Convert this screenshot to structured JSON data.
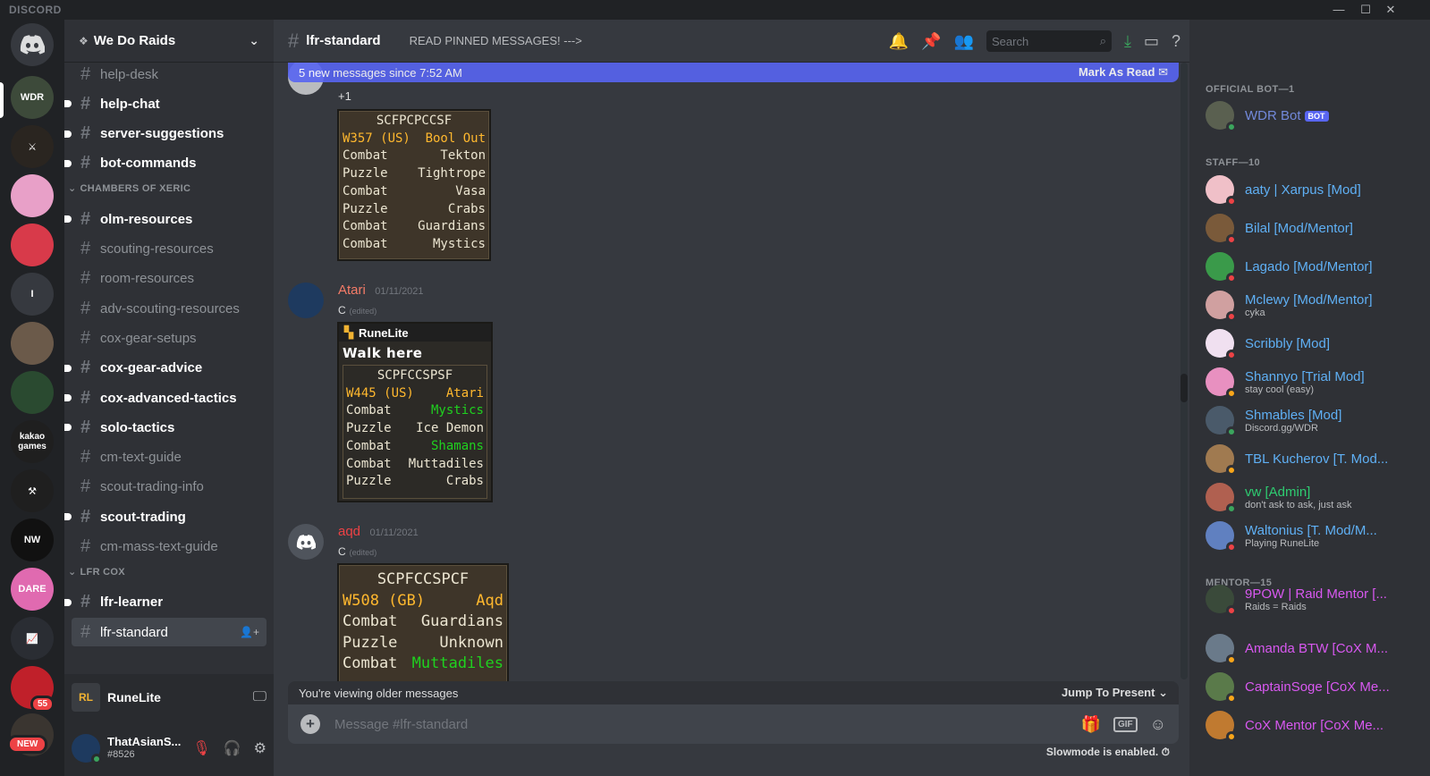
{
  "app": {
    "brand": "DISCORD"
  },
  "window_controls": {
    "minimize": "—",
    "maximize": "☐",
    "close": "✕"
  },
  "rail": {
    "home_icon": "discord-logo-icon",
    "servers": [
      {
        "label": "WDR",
        "color": "#3d4a3a"
      },
      {
        "label": "⚔",
        "color": "#2a2520"
      },
      {
        "label": "",
        "color": "#e8a0c8"
      },
      {
        "label": "",
        "color": "#d83a4a"
      },
      {
        "label": "I",
        "color": "#36393f"
      },
      {
        "label": "",
        "color": "#6b5a4a"
      },
      {
        "label": "",
        "color": "#2a4a30"
      },
      {
        "label": "kakao games",
        "color": "#1f1f1f"
      },
      {
        "label": "⚒",
        "color": "#1f1f1f"
      },
      {
        "label": "NW",
        "color": "#111111"
      },
      {
        "label": "DARE",
        "color": "#e06ab0"
      },
      {
        "label": "📈",
        "color": "#2a2d33"
      },
      {
        "label": "",
        "color": "#c0202a"
      },
      {
        "label": "",
        "color": "#3a3530"
      }
    ],
    "mention_badge": "55",
    "new_badge": "NEW"
  },
  "guild": {
    "name": "We Do Raids"
  },
  "channels": {
    "top": [
      {
        "name": "help-desk",
        "unread": false
      },
      {
        "name": "help-chat",
        "unread": true
      },
      {
        "name": "server-suggestions",
        "unread": true
      },
      {
        "name": "bot-commands",
        "unread": true
      }
    ],
    "cat1": "CHAMBERS OF XERIC",
    "cox": [
      {
        "name": "olm-resources",
        "unread": true
      },
      {
        "name": "scouting-resources",
        "unread": false
      },
      {
        "name": "room-resources",
        "unread": false
      },
      {
        "name": "adv-scouting-resources",
        "unread": false
      },
      {
        "name": "cox-gear-setups",
        "unread": false
      },
      {
        "name": "cox-gear-advice",
        "unread": true
      },
      {
        "name": "cox-advanced-tactics",
        "unread": true
      },
      {
        "name": "solo-tactics",
        "unread": true
      },
      {
        "name": "cm-text-guide",
        "unread": false
      },
      {
        "name": "scout-trading-info",
        "unread": false
      },
      {
        "name": "scout-trading",
        "unread": true
      },
      {
        "name": "cm-mass-text-guide",
        "unread": false
      }
    ],
    "cat2": "LFR COX",
    "lfr": [
      {
        "name": "lfr-learner",
        "unread": true
      },
      {
        "name": "lfr-standard",
        "selected": true
      }
    ]
  },
  "stream": {
    "name": "RuneLite"
  },
  "user": {
    "name": "ThatAsianS...",
    "tag": "#8526"
  },
  "chat": {
    "channel": "lfr-standard",
    "topic": "READ PINNED MESSAGES! --->",
    "search_placeholder": "Search",
    "new_banner": "5 new messages since 7:52 AM",
    "mark_read": "Mark As Read",
    "older": "You're viewing older messages",
    "jump": "Jump To Present",
    "composer_placeholder": "Message #lfr-standard",
    "gif": "GIF",
    "slowmode": "Slowmode is enabled."
  },
  "messages": [
    {
      "text": "+1",
      "card": {
        "title": "SCFPCPCCSF",
        "rows": [
          {
            "l": "W357 (US)",
            "r": "Bool Out",
            "lc": "ylw",
            "rc": "ylw"
          },
          {
            "l": "Combat",
            "r": "Tekton",
            "lc": "wht",
            "rc": "wht"
          },
          {
            "l": "Puzzle",
            "r": "Tightrope",
            "lc": "wht",
            "rc": "wht"
          },
          {
            "l": "Combat",
            "r": "Vasa",
            "lc": "wht",
            "rc": "wht"
          },
          {
            "l": "Puzzle",
            "r": "Crabs",
            "lc": "wht",
            "rc": "wht"
          },
          {
            "l": "Combat",
            "r": "Guardians",
            "lc": "wht",
            "rc": "wht"
          },
          {
            "l": "Combat",
            "r": "Mystics",
            "lc": "wht",
            "rc": "wht"
          }
        ]
      }
    },
    {
      "author": "Atari",
      "color": "#f47b67",
      "time": "01/11/2021",
      "text": "C",
      "edited": "(edited)",
      "rl_title": "RuneLite",
      "walk": "Walk here",
      "card": {
        "title": "SCPFCCSPSF",
        "rows": [
          {
            "l": "W445 (US)",
            "r": "Atari",
            "lc": "ylw",
            "rc": "ylw"
          },
          {
            "l": "Combat",
            "r": "Mystics",
            "lc": "wht",
            "rc": "grn"
          },
          {
            "l": "Puzzle",
            "r": "Ice Demon",
            "lc": "wht",
            "rc": "wht"
          },
          {
            "l": "Combat",
            "r": "Shamans",
            "lc": "wht",
            "rc": "grn"
          },
          {
            "l": "Combat",
            "r": "Muttadiles",
            "lc": "wht",
            "rc": "wht"
          },
          {
            "l": "Puzzle",
            "r": "Crabs",
            "lc": "wht",
            "rc": "wht"
          }
        ]
      }
    },
    {
      "author": "aqd",
      "color": "#ed4245",
      "time": "01/11/2021",
      "text": "C",
      "edited": "(edited)",
      "card": {
        "title": "SCPFCCSPCF",
        "rows": [
          {
            "l": "W508 (GB)",
            "r": "Aqd",
            "lc": "ylw",
            "rc": "ylw"
          },
          {
            "l": "Combat",
            "r": "Guardians",
            "lc": "wht",
            "rc": "wht"
          },
          {
            "l": "Puzzle",
            "r": "Unknown",
            "lc": "wht",
            "rc": "wht"
          },
          {
            "l": "Combat",
            "r": "Muttadiles",
            "lc": "wht",
            "rc": "grn"
          }
        ]
      }
    }
  ],
  "members": {
    "sections": [
      {
        "title": "OFFICIAL BOT—1"
      },
      {
        "title": "STAFF—10"
      },
      {
        "title": "MENTOR—15"
      }
    ],
    "list": [
      {
        "name": "WDR Bot",
        "color": "#7289da",
        "bot": "BOT",
        "status": "",
        "sd": "#3ba55d",
        "av": "#5a6050"
      },
      {
        "name": "aaty | Xarpus [Mod]",
        "color": "#5fb0f5",
        "status": "",
        "sd": "#ed4245",
        "av": "#f0c0c8"
      },
      {
        "name": "Bilal [Mod/Mentor]",
        "color": "#5fb0f5",
        "status": "",
        "sd": "#ed4245",
        "av": "#7a5a3a"
      },
      {
        "name": "Lagado [Mod/Mentor]",
        "color": "#5fb0f5",
        "status": "",
        "sd": "#ed4245",
        "av": "#3a9a4a"
      },
      {
        "name": "Mclewy [Mod/Mentor]",
        "color": "#5fb0f5",
        "status": "cyka",
        "sd": "#ed4245",
        "av": "#d0a0a0"
      },
      {
        "name": "Scribbly [Mod]",
        "color": "#5fb0f5",
        "status": "",
        "sd": "#ed4245",
        "av": "#f0e0f0"
      },
      {
        "name": "Shannyo [Trial Mod]",
        "color": "#5fb0f5",
        "status": "stay cool (easy)",
        "sd": "#faa61a",
        "av": "#e890c0"
      },
      {
        "name": "Shmables [Mod]",
        "color": "#5fb0f5",
        "status": "Discord.gg/WDR",
        "sd": "#3ba55d",
        "av": "#4a5a6a"
      },
      {
        "name": "TBL Kucherov [T. Mod...",
        "color": "#5fb0f5",
        "status": "",
        "sd": "#faa61a",
        "av": "#a07a50"
      },
      {
        "name": "vw [Admin]",
        "color": "#2ecc71",
        "status": "don't ask to ask, just ask",
        "sd": "#3ba55d",
        "av": "#b06050"
      },
      {
        "name": "Waltonius [T. Mod/M...",
        "color": "#5fb0f5",
        "status": "Playing RuneLite",
        "sd": "#ed4245",
        "av": "#6080c0"
      },
      {
        "name": "9POW | Raid Mentor [...",
        "color": "#d858f0",
        "status": "Raids = Raids",
        "sd": "#ed4245",
        "av": "#3a4a3a"
      },
      {
        "name": "Amanda BTW [CoX M...",
        "color": "#d858f0",
        "status": "",
        "sd": "#faa61a",
        "av": "#6a7a8a"
      },
      {
        "name": "CaptainSoge [CoX Me...",
        "color": "#d858f0",
        "status": "",
        "sd": "#faa61a",
        "av": "#5a7a4a"
      },
      {
        "name": "CoX Mentor [CoX Me...",
        "color": "#d858f0",
        "status": "",
        "sd": "#faa61a",
        "av": "#c07a30"
      }
    ]
  }
}
